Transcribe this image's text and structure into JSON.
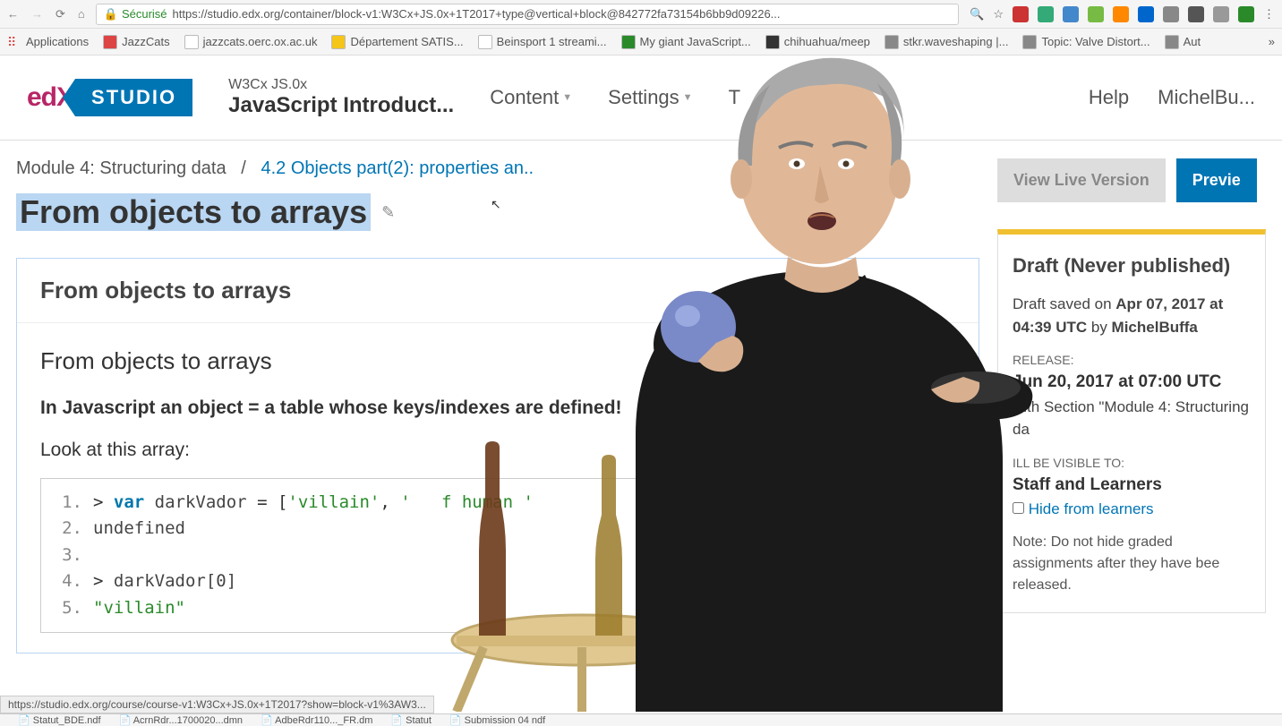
{
  "browser": {
    "secure_label": "Sécurisé",
    "url": "https://studio.edx.org/container/block-v1:W3Cx+JS.0x+1T2017+type@vertical+block@842772fa73154b6bb9d09226..."
  },
  "bookmarks": [
    {
      "label": "Applications",
      "color": "#d44"
    },
    {
      "label": "JazzCats",
      "color": "#d44"
    },
    {
      "label": "jazzcats.oerc.ox.ac.uk",
      "color": "#fff"
    },
    {
      "label": "Département SATIS...",
      "color": "#f5c518"
    },
    {
      "label": "Beinsport 1 streami...",
      "color": "#fff"
    },
    {
      "label": "My giant JavaScript...",
      "color": "#2a8a2a"
    },
    {
      "label": "chihuahua/meep",
      "color": "#333"
    },
    {
      "label": "stkr.waveshaping |...",
      "color": "#888"
    },
    {
      "label": "Topic: Valve Distort...",
      "color": "#888"
    },
    {
      "label": "Aut",
      "color": "#888"
    }
  ],
  "header": {
    "course_code": "W3Cx  JS.0x",
    "course_name": "JavaScript Introduct...",
    "nav": [
      "Content",
      "Settings",
      "T"
    ],
    "help": "Help",
    "user": "MichelBu..."
  },
  "breadcrumb": {
    "module": "Module 4: Structuring data",
    "sep": "/",
    "section": "4.2 Objects part(2): properties an.."
  },
  "page_title": "From objects to arrays",
  "unit": {
    "header": "From objects to arrays",
    "subheader": "From objects to arrays",
    "intro": "In Javascript an object = a table whose keys/indexes are defined!",
    "look": "Look at this array:",
    "code": [
      {
        "n": "1.",
        "html": "> <span class='kw-var'>var</span> <span class='ident'>darkVador</span> = [<span class='str'>'villain'</span>, <span class='str'>'   f human '</span>"
      },
      {
        "n": "2.",
        "html": "<span class='ident'>undefined</span>"
      },
      {
        "n": "3.",
        "html": ""
      },
      {
        "n": "4.",
        "html": "> <span class='ident'>darkVador[0]</span>"
      },
      {
        "n": "5.",
        "html": "<span class='str'>\"villain\"</span>"
      }
    ]
  },
  "actions": {
    "view_live": "View Live Version",
    "preview": "Previe"
  },
  "publish": {
    "status": "Draft (Never published)",
    "saved_prefix": "Draft saved on ",
    "saved_date": "Apr 07, 2017 at 04:39 UTC",
    "saved_by_prefix": " by ",
    "saved_by": "MichelBuffa",
    "release_label": "RELEASE:",
    "release_date": "Jun 20, 2017 at 07:00 UTC",
    "release_section": "with Section \"Module 4: Structuring da",
    "visible_label": "ILL BE VISIBLE TO:",
    "visible_value": "Staff and Learners",
    "hide_label": "Hide from learners",
    "note": "Note: Do not hide graded assignments after they have bee released."
  },
  "status_url": "https://studio.edx.org/course/course-v1:W3Cx+JS.0x+1T2017?show=block-v1%3AW3...",
  "downloads": [
    "Statut_BDE.ndf",
    "AcrnRdr...1700020...dmn",
    "AdbeRdr110..._FR.dm",
    "Statut",
    "Submission 04 ndf"
  ]
}
